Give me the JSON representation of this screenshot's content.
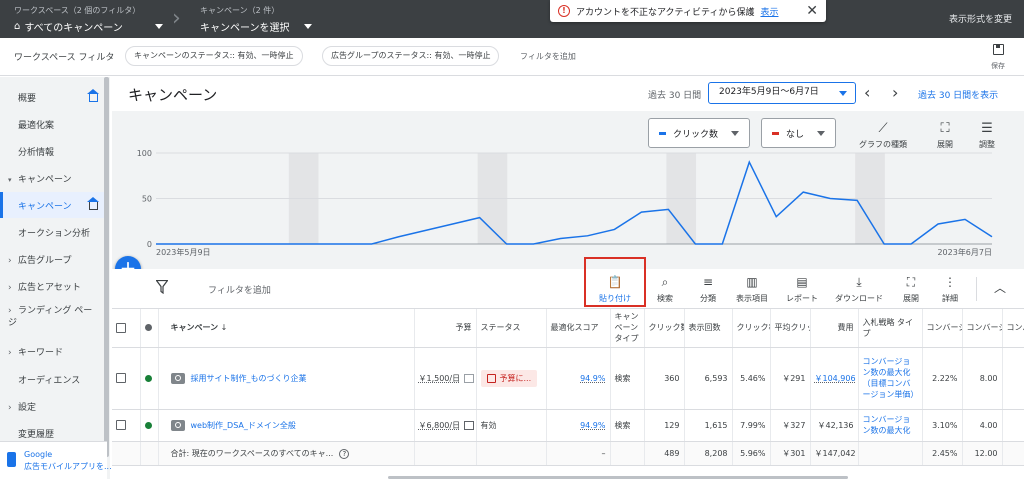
{
  "topbar": {
    "workspace_label": "ワークスペース（2 個のフィルタ）",
    "workspace_value": "すべてのキャンペーン",
    "campaign_label": "キャンペーン（2 件）",
    "campaign_value": "キャンペーンを選択",
    "notification_text": "アカウントを不正なアクティビティから保護",
    "notification_link": "表示",
    "view_change": "表示形式を変更"
  },
  "filterbar": {
    "label": "ワークスペース フィルタ",
    "chips": [
      "キャンペーンのステータス:: 有効、一時停止",
      "広告グループのステータス:: 有効、一時停止"
    ],
    "add_filter": "フィルタを追加",
    "save_label": "保存"
  },
  "sidebar": {
    "items": [
      {
        "label": "概要"
      },
      {
        "label": "最適化案"
      },
      {
        "label": "分析情報"
      },
      {
        "label": "キャンペーン"
      },
      {
        "label": "キャンペーン"
      },
      {
        "label": "オークション分析"
      },
      {
        "label": "広告グループ"
      },
      {
        "label": "広告とアセット"
      },
      {
        "label": "ランディング ページ"
      },
      {
        "label": "キーワード"
      },
      {
        "label": "オーディエンス"
      },
      {
        "label": "設定"
      },
      {
        "label": "変更履歴"
      }
    ],
    "mobile_ad_line1": "Google",
    "mobile_ad_line2": "広告モバイルアプリを..."
  },
  "header": {
    "title": "キャンペーン",
    "range_label": "過去 30 日間",
    "date_range": "2023年5月9日～6月7日",
    "show_link": "過去 30 日間を表示"
  },
  "chart_controls": {
    "metric1": "クリック数",
    "metric2": "なし",
    "tools": [
      "グラフの種類",
      "展開",
      "調整"
    ],
    "metric1_color": "#1a73e8",
    "metric2_color": "#d93025"
  },
  "chart_data": {
    "type": "line",
    "series": [
      {
        "values": [
          0,
          0,
          0,
          0,
          0,
          0,
          0,
          0,
          0,
          8,
          15,
          22,
          29,
          0,
          0,
          6,
          9,
          16,
          35,
          38,
          0,
          0,
          90,
          30,
          57,
          50,
          48,
          0,
          0,
          22,
          27,
          8
        ]
      }
    ],
    "x_start_label": "2023年5月9日",
    "x_end_label": "2023年6月7日",
    "yticks": [
      0,
      50,
      100
    ],
    "ylim": [
      0,
      100
    ],
    "weekend_bands": true,
    "grid": "horizontal"
  },
  "toolbar": {
    "filter_add": "フィルタを追加",
    "tools": [
      "貼り付け",
      "検索",
      "分類",
      "表示項目",
      "レポート",
      "ダウンロード",
      "展開",
      "詳細"
    ]
  },
  "table": {
    "headers": [
      "キャンペーン",
      "予算",
      "ステータス",
      "最適化スコア",
      "キャンペーン タイプ",
      "クリック数",
      "表示回数",
      "クリック率",
      "平均クリック単価",
      "費用",
      "入札戦略 タイプ",
      "コンバージョン",
      "コンバージョン単価",
      "コンバージョン"
    ],
    "rows": [
      {
        "name": "採用サイト制作_ものづくり企業",
        "budget": "￥1,500/日",
        "status": "予算に...",
        "opt_score": "94.9%",
        "type": "検索",
        "clicks": "360",
        "impressions": "6,593",
        "ctr": "5.46%",
        "cpc": "￥291",
        "cost": "￥104,906",
        "strategy": "コンバージョン数の最大化（目標コンバージョン単価）",
        "conv_rate": "2.22%",
        "conv": "8.00"
      },
      {
        "name": "web制作_DSA_ドメイン全般",
        "budget": "￥6,800/日",
        "status": "有効",
        "opt_score": "94.9%",
        "type": "検索",
        "clicks": "129",
        "impressions": "1,615",
        "ctr": "7.99%",
        "cpc": "￥327",
        "cost": "￥42,136",
        "strategy": "コンバージョン数の最大化",
        "conv_rate": "3.10%",
        "conv": "4.00"
      }
    ],
    "total": {
      "label": "合計: 現在のワークスペースのすべてのキャ...",
      "opt_score": "–",
      "clicks": "489",
      "impressions": "8,208",
      "ctr": "5.96%",
      "cpc": "￥301",
      "cost": "￥147,042",
      "conv_rate": "2.45%",
      "conv": "12.00"
    }
  }
}
